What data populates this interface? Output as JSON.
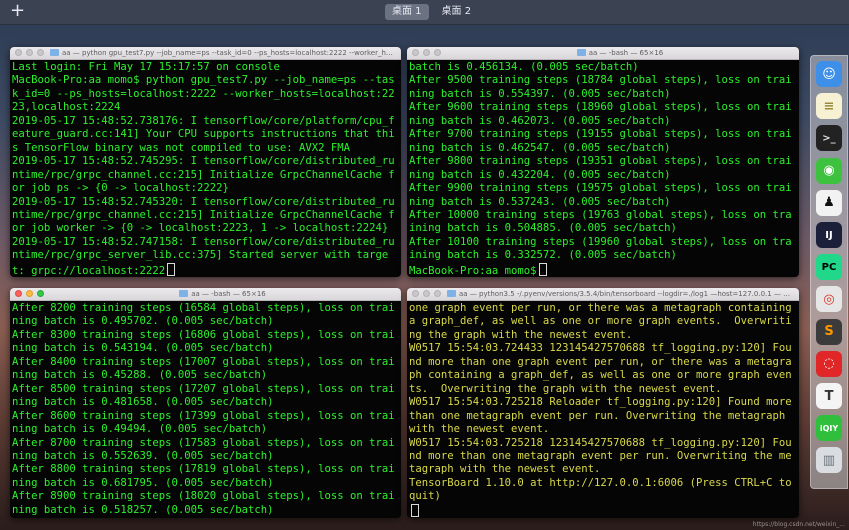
{
  "desktop": {
    "add_symbol": "+",
    "spaces": [
      "桌面 1",
      "桌面 2"
    ]
  },
  "windows": {
    "top_left": {
      "title": "aa — python gpu_test7.py --job_name=ps --task_id=0 --ps_hosts=localhost:2222 --worker_hosts=localh...",
      "lines": [
        "Last login: Fri May 17 15:17:57 on console",
        "MacBook-Pro:aa momo$ python gpu_test7.py --job_name=ps --task_id=0 --ps_hosts=localhost:2222 --worker_hosts=localhost:2223,localhost:2224",
        "2019-05-17 15:48:52.738176: I tensorflow/core/platform/cpu_feature_guard.cc:141] Your CPU supports instructions that this TensorFlow binary was not compiled to use: AVX2 FMA",
        "2019-05-17 15:48:52.745295: I tensorflow/core/distributed_runtime/rpc/grpc_channel.cc:215] Initialize GrpcChannelCache for job ps -> {0 -> localhost:2222}",
        "2019-05-17 15:48:52.745320: I tensorflow/core/distributed_runtime/rpc/grpc_channel.cc:215] Initialize GrpcChannelCache for job worker -> {0 -> localhost:2223, 1 -> localhost:2224}",
        "2019-05-17 15:48:52.747158: I tensorflow/core/distributed_runtime/rpc/grpc_server_lib.cc:375] Started server with target: grpc://localhost:2222"
      ]
    },
    "top_right": {
      "title": "aa — -bash — 65×16",
      "lines": [
        "batch is 0.456134. (0.005 sec/batch)",
        "After 9500 training steps (18784 global steps), loss on training batch is 0.554397. (0.005 sec/batch)",
        "After 9600 training steps (18960 global steps), loss on training batch is 0.462073. (0.005 sec/batch)",
        "After 9700 training steps (19155 global steps), loss on training batch is 0.462547. (0.005 sec/batch)",
        "After 9800 training steps (19351 global steps), loss on training batch is 0.432204. (0.005 sec/batch)",
        "After 9900 training steps (19575 global steps), loss on training batch is 0.537243. (0.005 sec/batch)",
        "After 10000 training steps (19763 global steps), loss on training batch is 0.504885. (0.005 sec/batch)",
        "After 10100 training steps (19960 global steps), loss on training batch is 0.332572. (0.005 sec/batch)",
        "MacBook-Pro:aa momo$"
      ]
    },
    "bottom_left": {
      "title": "aa — -bash — 65×16",
      "lines": [
        "After 8200 training steps (16584 global steps), loss on training batch is 0.495702. (0.005 sec/batch)",
        "After 8300 training steps (16806 global steps), loss on training batch is 0.543194. (0.005 sec/batch)",
        "After 8400 training steps (17007 global steps), loss on training batch is 0.45288. (0.005 sec/batch)",
        "After 8500 training steps (17207 global steps), loss on training batch is 0.481658. (0.005 sec/batch)",
        "After 8600 training steps (17399 global steps), loss on training batch is 0.49494. (0.005 sec/batch)",
        "After 8700 training steps (17583 global steps), loss on training batch is 0.552639. (0.005 sec/batch)",
        "After 8800 training steps (17819 global steps), loss on training batch is 0.681795. (0.005 sec/batch)",
        "After 8900 training steps (18020 global steps), loss on training batch is 0.518257. (0.005 sec/batch)"
      ]
    },
    "bottom_right": {
      "title": "aa — python3.5 -/.pyenv/versions/3.5.4/bin/tensorboard --logdir=./log1 —host=127.0.0.1 — 65×16",
      "lines": [
        "one graph event per run, or there was a metagraph containing a graph_def, as well as one or more graph events.  Overwriting the graph with the newest event.",
        "W0517 15:54:03.724433 123145427570688 tf_logging.py:120] Found more than one graph event per run, or there was a metagraph containing a graph_def, as well as one or more graph events.  Overwriting the graph with the newest event.",
        "W0517 15:54:03.725218 Reloader tf_logging.py:120] Found more than one metagraph event per run. Overwriting the metagraph with the newest event.",
        "W0517 15:54:03.725218 123145427570688 tf_logging.py:120] Found more than one metagraph event per run. Overwriting the metagraph with the newest event.",
        "TensorBoard 1.10.0 at http://127.0.0.1:6006 (Press CTRL+C to quit)"
      ]
    }
  },
  "dock": {
    "apps": [
      {
        "name": "finder",
        "glyph": "☺",
        "bg": "#3d8fe8",
        "fg": "#ffffff"
      },
      {
        "name": "notes",
        "glyph": "≡",
        "bg": "#f6f1d2",
        "fg": "#9c8a3a"
      },
      {
        "name": "terminal",
        "glyph": ">_",
        "bg": "#222222",
        "fg": "#e0e0e0"
      },
      {
        "name": "wechat",
        "glyph": "◉",
        "bg": "#3ec13e",
        "fg": "#ffffff"
      },
      {
        "name": "qq",
        "glyph": "♟",
        "bg": "#f2f2f2",
        "fg": "#111111"
      },
      {
        "name": "intellij",
        "glyph": "IJ",
        "bg": "#1b1f3a",
        "fg": "#ffffff"
      },
      {
        "name": "pycharm",
        "glyph": "PC",
        "bg": "#21d789",
        "fg": "#000000"
      },
      {
        "name": "chrome",
        "glyph": "◎",
        "bg": "#e6e6e6",
        "fg": "#d93025"
      },
      {
        "name": "sublime",
        "glyph": "S",
        "bg": "#3b3b3b",
        "fg": "#ff9800"
      },
      {
        "name": "netease-music",
        "glyph": "◌",
        "bg": "#e02626",
        "fg": "#ffffff"
      },
      {
        "name": "typora",
        "glyph": "T",
        "bg": "#f4f4f4",
        "fg": "#333333"
      },
      {
        "name": "iqiyi",
        "glyph": "iQIY",
        "bg": "#2fbf3c",
        "fg": "#ffffff"
      },
      {
        "name": "trash",
        "glyph": "▥",
        "bg": "#d9dde2",
        "fg": "#6b7078"
      }
    ]
  },
  "watermark": "https://blog.csdn.net/weixin_..."
}
